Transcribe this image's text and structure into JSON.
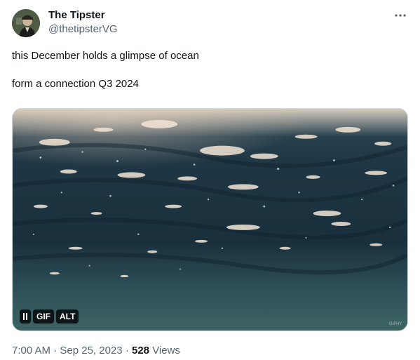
{
  "author": {
    "display_name": "The Tipster",
    "handle": "@thetipsterVG",
    "avatar_icon": "avatar-portrait"
  },
  "more_icon": "more-horizontal-icon",
  "tweet": {
    "lines": [
      "this December holds a glimpse of ocean",
      "form a connection Q3 2024"
    ]
  },
  "media": {
    "type": "gif",
    "scene": "underwater ocean surface",
    "controls": {
      "pause_icon": "pause-icon",
      "gif_label": "GIF",
      "alt_label": "ALT"
    },
    "watermark": "GIPHY"
  },
  "meta": {
    "time": "7:00 AM",
    "separator": "·",
    "date": "Sep 25, 2023",
    "views_count": "528",
    "views_label": "Views"
  },
  "colors": {
    "text": "#0f1419",
    "secondary_text": "#536471",
    "border": "#cfd9de",
    "control_bg": "#000000c4"
  }
}
